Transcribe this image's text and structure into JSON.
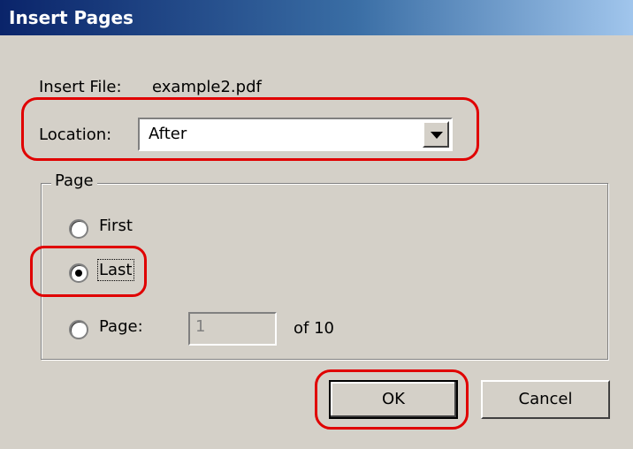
{
  "window": {
    "title": "Insert Pages"
  },
  "insert_file": {
    "label": "Insert File:",
    "value": "example2.pdf"
  },
  "location": {
    "label": "Location:",
    "selected": "After"
  },
  "page_group": {
    "legend": "Page",
    "options": [
      {
        "label": "First",
        "checked": false
      },
      {
        "label": "Last",
        "checked": true
      },
      {
        "label": "Page:",
        "checked": false
      }
    ],
    "page_number": "1",
    "of_label": "of 10"
  },
  "buttons": {
    "ok": "OK",
    "cancel": "Cancel"
  },
  "colors": {
    "highlight": "#e00000",
    "title_start": "#0a246a",
    "title_end": "#a6caf0",
    "dialog_bg": "#d4d0c8"
  }
}
